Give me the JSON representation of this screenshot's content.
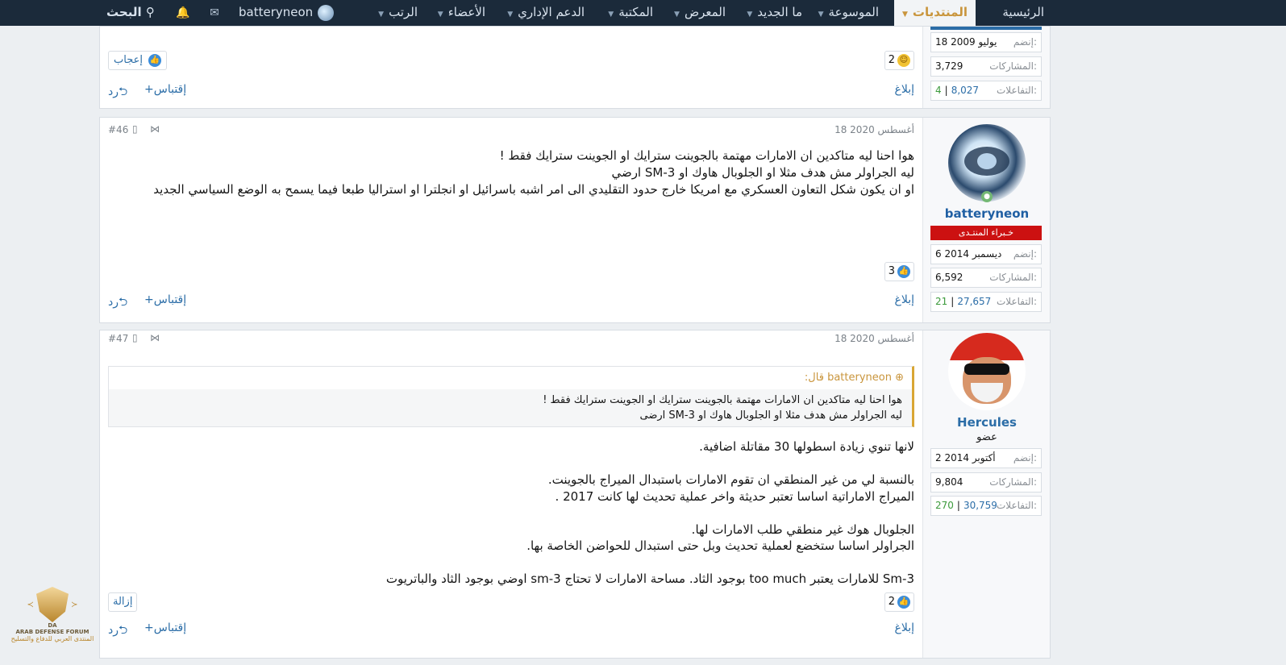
{
  "nav": {
    "home": "الرئيسية",
    "forums": "المنتديات",
    "wiki": "الموسوعة",
    "whats_new": "ما الجديد",
    "gallery": "المعرض",
    "library": "المكتبة",
    "support": "الدعم الإداري",
    "members": "الأعضاء",
    "ranks": "الرتب",
    "username": "batteryneon",
    "search": "البحث"
  },
  "post_prev": {
    "joined_label": "إنضم:",
    "joined": "18 يوليو 2009",
    "posts_label": "المشاركات:",
    "posts": "3,729",
    "reactions_label": "التفاعلات:",
    "reactions": "8,027",
    "points": "4",
    "reaction_count": "2",
    "like_label": "إعجاب",
    "report": "إبلاغ",
    "quote": "إقتباس",
    "reply": "رد"
  },
  "post_46": {
    "date": "18 أغسطس 2020",
    "number": "#46",
    "username": "batteryneon",
    "user_title": "خـبراء المنتـدى",
    "joined_label": "إنضم:",
    "joined": "6 ديسمبر 2014",
    "posts_label": "المشاركات:",
    "posts": "6,592",
    "reactions_label": "التفاعلات:",
    "reactions": "27,657",
    "points": "21",
    "lines": [
      "هوا احنا ليه متاكدين ان الامارات مهتمة بالجوينت سترايك او الجوينت سترايك فقط !",
      "ليه الجراولر مش هدف مثلا او الجلوبال هاوك او SM-3 ارضي",
      "او ان يكون شكل التعاون العسكري مع امريكا خارج حدود التقليدي الى امر اشبه باسرائيل او انجلترا او استراليا طبعا فيما يسمح به الوضع السياسي الجديد"
    ],
    "reaction_count": "3",
    "report": "إبلاغ",
    "quote": "إقتباس",
    "reply": "رد"
  },
  "post_47": {
    "date": "18 أغسطس 2020",
    "number": "#47",
    "username": "Hercules",
    "user_title": "عضو",
    "joined_label": "إنضم:",
    "joined": "2 أكتوبر 2014",
    "posts_label": "المشاركات:",
    "posts": "9,804",
    "reactions_label": "التفاعلات:",
    "reactions": "30,759",
    "points": "270",
    "quote_author": "batteryneon قال:",
    "quote_lines": [
      "هوا احنا ليه متاكدين ان الامارات مهتمة بالجوينت سترايك او الجوينت سترايك فقط !",
      "ليه الجراولر مش هدف مثلا او الجلوبال هاوك او SM-3 ارضى"
    ],
    "lines": [
      "لانها تنوي زيادة اسطولها 30 مقاتلة اضافية.",
      "",
      "بالنسبة لي من غير المنطقي ان تقوم الامارات باستبدال الميراج بالجوينت.",
      "الميراج الاماراتية اساسا تعتبر حديثة واخر عملية تحديث لها كانت 2017 .",
      "",
      "الجلوبال هوك غير منطقي طلب الامارات لها.",
      "الجراولر اساسا ستخضع لعملية تحديث وبل حتى استبدال للحواضن الخاصة بها.",
      "",
      "Sm-3 للامارات يعتبر too much بوجود الثاد. مساحة الامارات لا تحتاج sm-3 اوضي بوجود الثاد والباتريوت"
    ],
    "reaction_count": "2",
    "remove": "إزالة",
    "report": "إبلاغ",
    "quote": "إقتباس",
    "reply": "رد"
  },
  "logo": {
    "emblem": "DA",
    "name_en": "ARAB DEFENSE FORUM",
    "name_ar": "المنتدى العربي للدفاع والتسليح"
  }
}
